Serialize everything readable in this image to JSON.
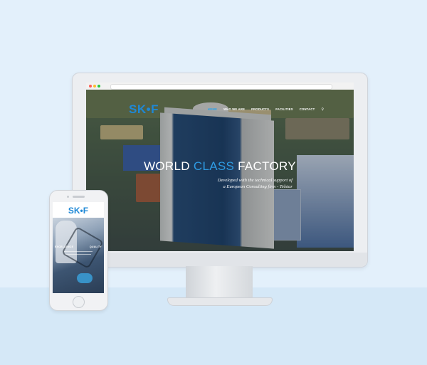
{
  "desktop": {
    "site": {
      "logo_text": "SK•F",
      "nav": [
        {
          "label": "HOME",
          "active": true
        },
        {
          "label": "WHO WE ARE",
          "active": false
        },
        {
          "label": "PRODUCTS",
          "active": false
        },
        {
          "label": "FACILITIES",
          "active": false
        },
        {
          "label": "CONTACT",
          "active": false
        }
      ],
      "search_icon": "search-icon"
    },
    "hero": {
      "title_part1": "WORLD ",
      "title_accent": "CLASS",
      "title_part2": " FACTORY",
      "subtitle_line1": "Developed with the technical support of",
      "subtitle_line2": "a European Consulting firm - Telstar"
    }
  },
  "mobile": {
    "logo_text": "SK•F",
    "tagline_left": "EXCELLENCE",
    "tagline_right": "QUALITY"
  },
  "colors": {
    "brand_blue": "#1e88d6",
    "accent": "#2e9be3",
    "background": "#e3f0fb"
  }
}
